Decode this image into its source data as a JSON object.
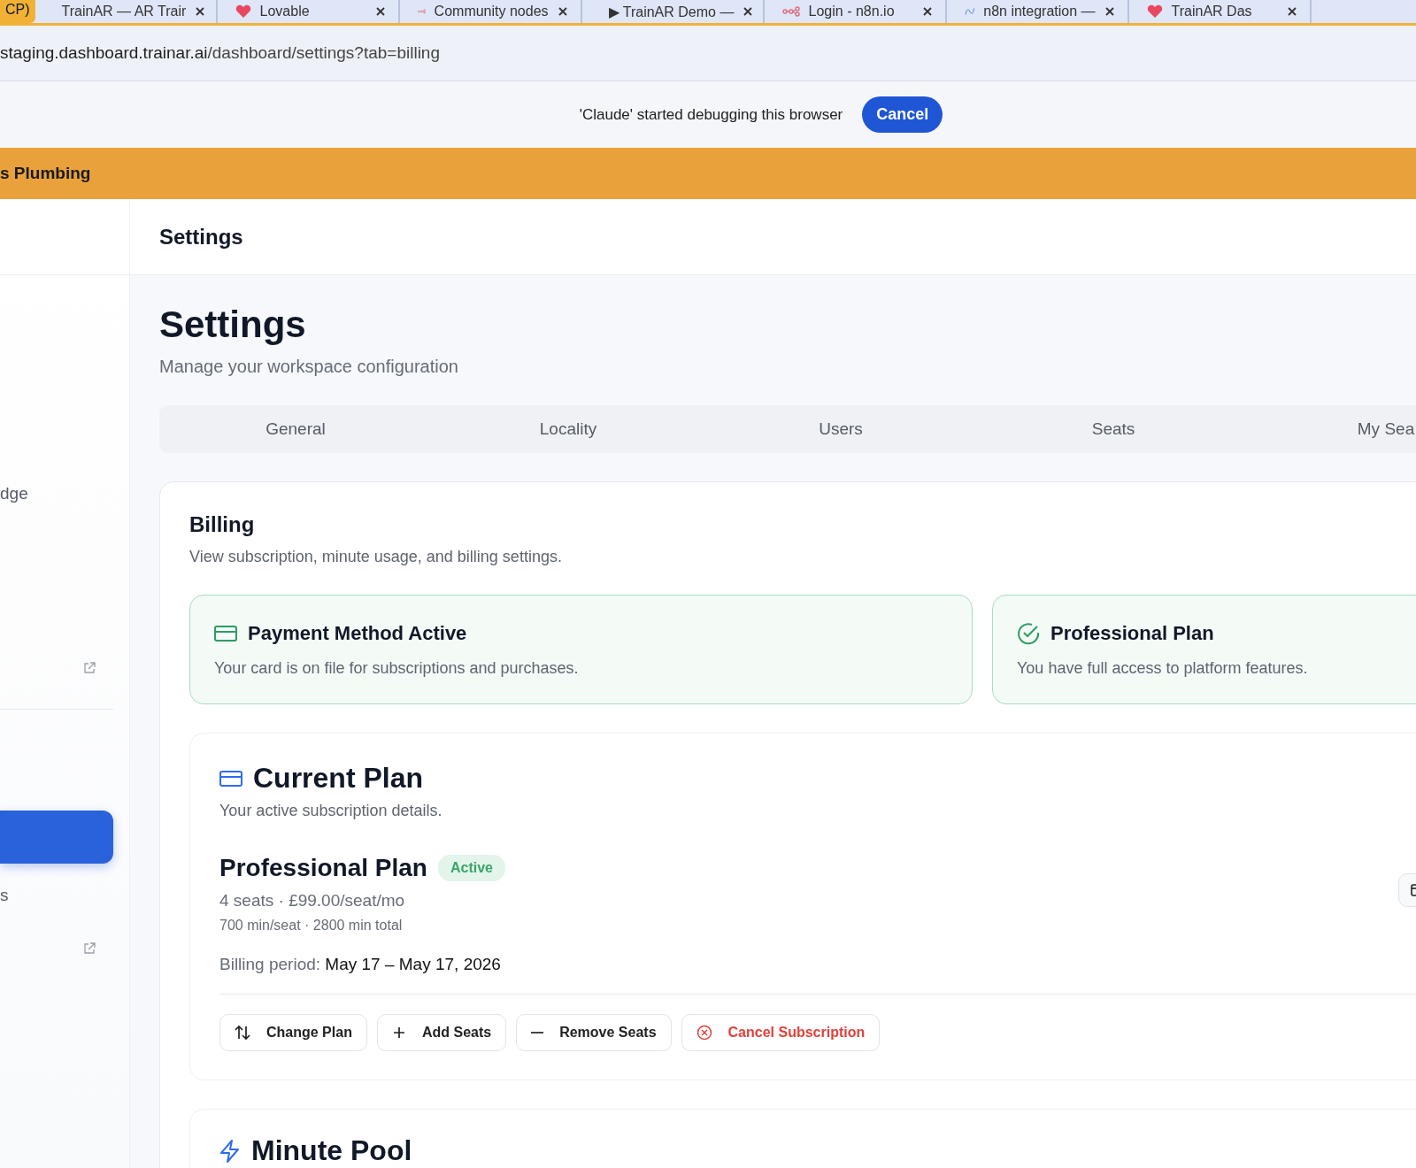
{
  "browser": {
    "group_label": "CP)",
    "tabs": [
      {
        "title": "TrainAR — AR Trair",
        "kind": "infinity"
      },
      {
        "title": "Lovable",
        "kind": "heart"
      },
      {
        "title": "Community nodes",
        "kind": "nodes"
      },
      {
        "title": "▶ TrainAR Demo —",
        "kind": "nodes"
      },
      {
        "title": "Login - n8n.io",
        "kind": "nodes"
      },
      {
        "title": "n8n integration —",
        "kind": "wave"
      },
      {
        "title": "TrainAR Das",
        "kind": "heart"
      }
    ],
    "address_host": "staging.dashboard.trainar.ai",
    "address_path": "/dashboard/settings?tab=billing"
  },
  "debug_bar": {
    "message": "'Claude' started debugging this browser",
    "button": "Cancel"
  },
  "org_banner": {
    "name": "s Plumbing"
  },
  "sidebar": {
    "sections": [
      [
        {
          "label": "dge",
          "selected": false,
          "external_link": false
        },
        {
          "selected": false,
          "external_link": true
        }
      ],
      [
        {
          "selected": true,
          "external_link": false
        },
        {
          "label": "s",
          "selected": false,
          "external_link": false
        },
        {
          "selected": false,
          "external_link": true
        }
      ]
    ]
  },
  "header": {
    "title": "Settings"
  },
  "page": {
    "title": "Settings",
    "subtitle": "Manage your workspace configuration"
  },
  "tabs": [
    {
      "label": "General",
      "selected": false
    },
    {
      "label": "Locality",
      "selected": false
    },
    {
      "label": "Users",
      "selected": false
    },
    {
      "label": "Seats",
      "selected": false
    },
    {
      "label": "My Sea",
      "selected": false
    }
  ],
  "billing": {
    "title": "Billing",
    "description": "View subscription, minute usage, and billing settings.",
    "status_cards": [
      {
        "kind": "card",
        "title": "Payment Method Active",
        "text": "Your card is on file for subscriptions and purchases."
      },
      {
        "kind": "check",
        "title": "Professional Plan",
        "text": "You have full access to platform features."
      }
    ],
    "current_plan": {
      "title": "Current Plan",
      "subtitle": "Your active subscription details.",
      "plan_name": "Professional Plan",
      "status": "Active",
      "price": "4 seats · £99.00/seat/mo",
      "minutes": "700 min/seat · 2800 min total",
      "period_label": "Billing period:",
      "period_value": "May 17 – May 17, 2026",
      "actions": [
        {
          "label": "Change Plan",
          "kind": "swap"
        },
        {
          "label": "Add Seats",
          "kind": "add"
        },
        {
          "label": "Remove Seats",
          "kind": "remove"
        },
        {
          "label": "Cancel Subscription",
          "kind": "cancel"
        }
      ]
    },
    "minute_pool": {
      "title": "Minute Pool"
    }
  }
}
